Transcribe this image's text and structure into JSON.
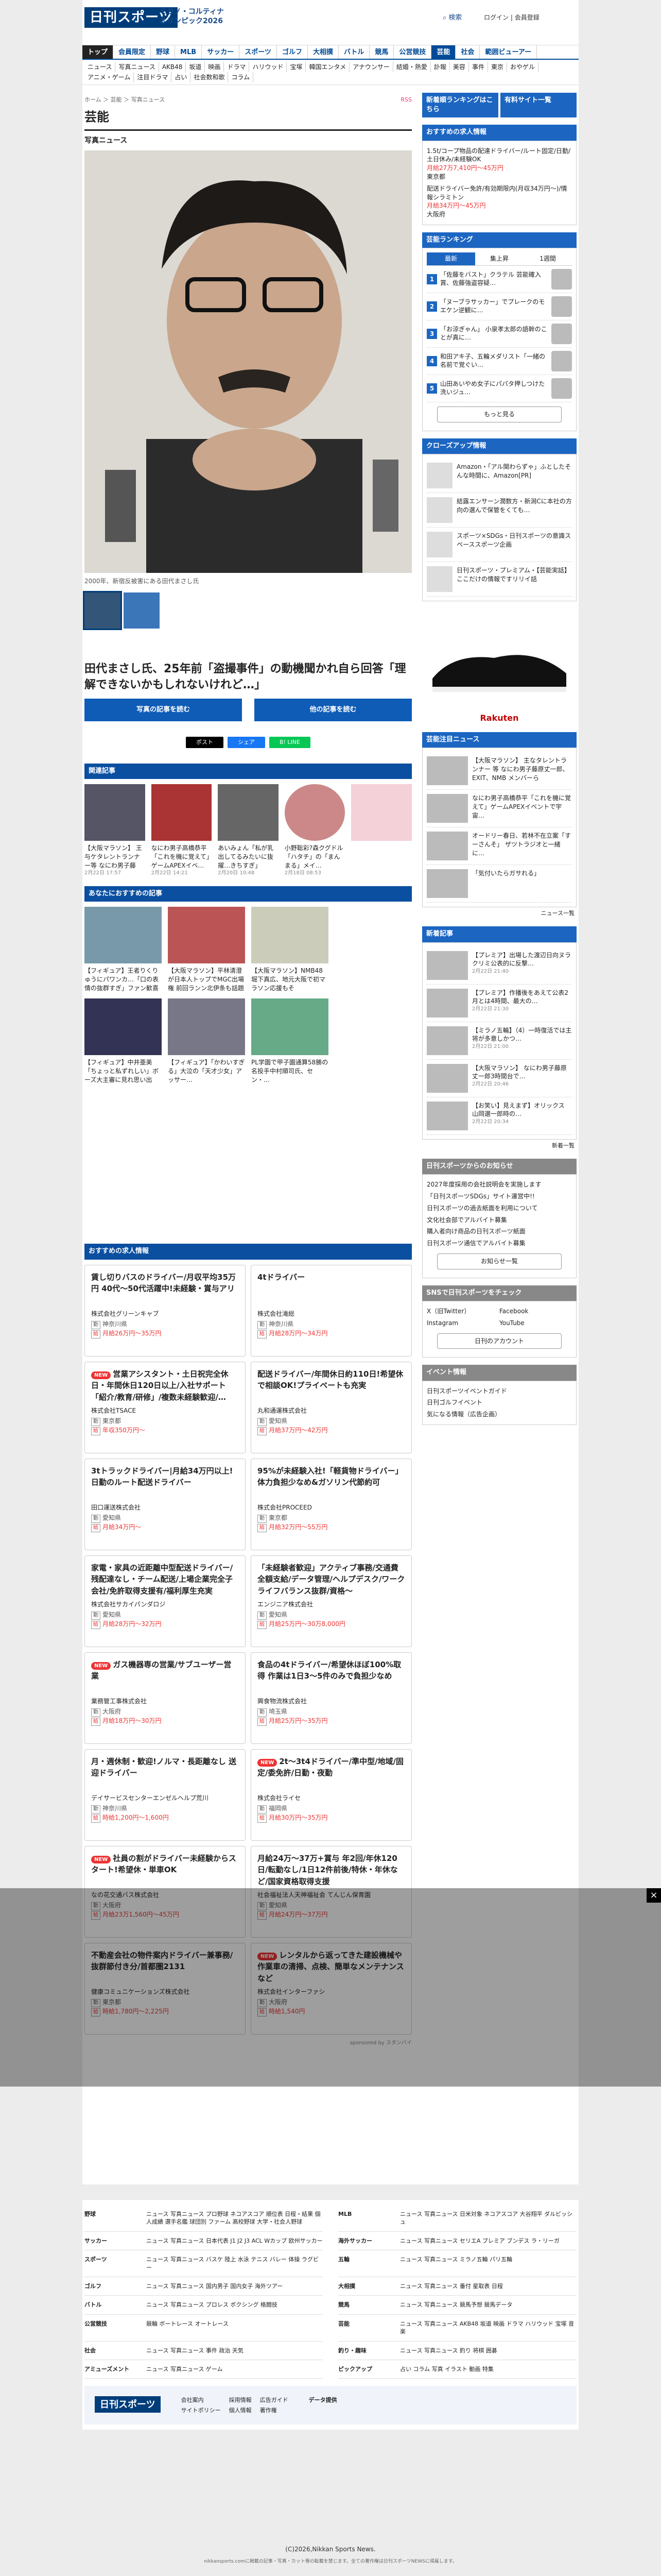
{
  "header": {
    "logo": "日刊スポーツ",
    "campaign": "ミラノ・コルティナ オリンピック2026",
    "search": "検索",
    "login": "ログイン",
    "register": "会員登録"
  },
  "nav": [
    "トップ",
    "会員限定",
    "野球",
    "MLB",
    "サッカー",
    "スポーツ",
    "ゴルフ",
    "大相撲",
    "バトル",
    "競馬",
    "公営競技",
    "芸能",
    "社会",
    "範囲ビューアー"
  ],
  "subnav": [
    "ニュース",
    "写真ニュース",
    "AKB48",
    "坂道",
    "映画",
    "ドラマ",
    "ハリウッド",
    "宝塚",
    "韓国エンタメ",
    "アナウンサー",
    "結婚・熱愛",
    "訃報",
    "美容",
    "事件",
    "東京",
    "おやゲル",
    "アニメ・ゲーム",
    "注目ドラマ",
    "占い",
    "社会数和歌",
    "コラム"
  ],
  "crumb": "ホーム ＞ 芸能 ＞ 写真ニュース",
  "rss": "RSS",
  "page_title": "芸能",
  "photo_heading": "写真ニュース",
  "caption": "2000年、新宿反被害にある田代まさし氏",
  "headline": "田代まさし氏、25年前「盗撮事件」の動機聞かれ自ら回答「理解できないかもしれないけれど…」",
  "prev_btn": "写真の記事を読む",
  "next_btn": "他の記事を読む",
  "share": [
    "ポスト",
    "シェア",
    "B! LINE",
    "はてな"
  ],
  "related_title": "関連記事",
  "related": [
    {
      "t": "【大阪マラソン】 王与ケタレントランナー等 なにわ男子藤原…",
      "d": "2月22日 17:57"
    },
    {
      "t": "なにわ男子高橋恭平「これを機に覚えて」ゲームAPEXイベ…",
      "d": "2月22日 14:21"
    },
    {
      "t": "あいみょん「私が乳出してるみたいに抜擢…きちすぎ」",
      "d": "2月20日 10:48"
    },
    {
      "t": "小野聡彩?森クグドル「ハタチ」の「まんまる」メイ…",
      "d": "2月18日 08:53"
    },
    {
      "t": "",
      "d": ""
    }
  ],
  "rec_title": "あなたにおすすめの記事",
  "rec": [
    {
      "t": "【フィギュア】王者りくりゅうにパワンカ…「口の表情の抜群すぎ」ファン歓喜"
    },
    {
      "t": "【大阪マラソン】平林清澄が日本人トップでMGC出場権 前回ランン北伊条も話題"
    },
    {
      "t": "【大阪マラソン】NMB48堀下真広、地元大阪で初マラソン応援もそ"
    },
    {
      "t": "",
      "d": ""
    },
    {
      "t": "【フィギュア】中井亜美「ちょっと私ずれしい」ボーズ大主審に見れ思い出"
    },
    {
      "t": "【フィギュア】「かわいすぎる」大泣の「天才少女」アッサー…"
    },
    {
      "t": "PL学園で甲子園通算58勝の名投手中村順司氏、セン・…"
    },
    {
      "t": "",
      "d": ""
    }
  ],
  "jobs_title": "おすすめの求人情報",
  "jobs": [
    {
      "new": false,
      "t": "賃し切りバスのドライバー/月収平均35万円 40代〜50代活躍中!未経験・賞与アリ",
      "co": "株式会社グリーンキャブ",
      "pref": "神奈川県",
      "pay": "月給26万円〜35万円"
    },
    {
      "new": false,
      "t": "4tドライバー",
      "co": "株式会社滝総",
      "pref": "神奈川県",
      "pay": "月給28万円〜34万円"
    },
    {
      "new": true,
      "t": "営業アシスタント・土日祝完全休日・年間休日120日以上/入社サポート「紹介/教育/研修」/複数未経験歓迎/…",
      "co": "株式会社TSACE",
      "pref": "東京都",
      "pay": "年収350万円〜"
    },
    {
      "new": false,
      "t": "配送ドライバー/年間休日約110日!希望休で相談OK!プライベートも充実",
      "co": "丸和通運株式会社",
      "pref": "愛知県",
      "pay": "月給37万円〜42万円"
    },
    {
      "new": false,
      "t": "3tトラックドライバー|月給34万円以上!日勤のルート配送ドライバー",
      "co": "田口運送株式会社",
      "pref": "愛知県",
      "pay": "月給34万円〜"
    },
    {
      "new": false,
      "t": "95%が未経験入社!「軽貨物ドライバー」体力負担少なめ&ガソリン代節約可",
      "co": "株式会社PROCEED",
      "pref": "東京都",
      "pay": "月給32万円〜55万円"
    },
    {
      "new": false,
      "t": "家電・家具の近距離中型配送ドライバー/残配達なし・チーム配送/上場企業完全子会社/免許取得支援有/福利厚生充実",
      "co": "株式会社サカイパンダロジ",
      "pref": "愛知県",
      "pay": "月給28万円〜32万円"
    },
    {
      "new": false,
      "t": "「未経験者歓迎」アクティブ事務/交通費全額支給/データ管理/ヘルプデスク/ワークライフバランス抜群/資格〜",
      "co": "エンジニア株式会社",
      "pref": "愛知県",
      "pay": "月給25万円〜30万8,000円"
    },
    {
      "new": true,
      "t": "ガス機器専の営業/サブユーザー営業",
      "co": "業務管工事株式会社",
      "pref": "大阪府",
      "pay": "月給18万円〜30万円"
    },
    {
      "new": false,
      "t": "食品の4tドライバー/希望休ほぼ100%取得 作業は1日3〜5件のみで負担少なめ",
      "co": "興食物流株式会社",
      "pref": "埼玉県",
      "pay": "月給25万円〜35万円"
    },
    {
      "new": false,
      "t": "月・週休制・歓迎!ノルマ・長距離なし 送迎ドライバー",
      "co": "デイサービスセンターエンゼルヘルプ荒川",
      "pref": "神奈川県",
      "pay": "時給1,200円〜1,600円"
    },
    {
      "new": true,
      "t": "2t〜3t4ドライバー/準中型/地域/固定/委免許/日勤・夜勤",
      "co": "株式会社ライセ",
      "pref": "福岡県",
      "pay": "月給30万円〜35万円"
    },
    {
      "new": true,
      "t": "社員の割がドライバー未経験からスタート!希望休・単車OK",
      "co": "なの花交通バス株式会社",
      "pref": "大阪府",
      "pay": "月給23万1,560円〜45万円"
    },
    {
      "new": false,
      "t": "月給24万〜37万+賞与 年2回/年休120日/転勤なし/1日12件前後/特休・年休など/国家資格取得支援",
      "co": "社会福祉法人天神福祉会 てんじん保育園",
      "pref": "愛知県",
      "pay": "月給24万円〜37万円"
    },
    {
      "new": false,
      "t": "不動産会社の物件案内ドライバー兼事務/抜群節付き分/首都圏2131",
      "co": "健康コミュニケーションズ株式会社",
      "pref": "東京都",
      "pay": "時給1,780円〜2,225円"
    },
    {
      "new": true,
      "t": "レンタルから返ってきた建設機械や作業車の清掃、点検、簡単なメンテナンスなど",
      "co": "株式会社インターファシ",
      "pref": "大阪府",
      "pay": "時給1,540円"
    }
  ],
  "sponsor": "sponsored by スタンバイ",
  "side": {
    "links": [
      "新着順ランキングはこちら",
      "有料サイト一覧"
    ],
    "jobs_title": "おすすめの求人情報",
    "jobs": [
      {
        "t": "1.5t/コープ物品の配達ドライバー/ルート固定/日勤/土日休み/未経験OK",
        "pay": "月給27万7,410円〜45万円",
        "pref": "東京都"
      },
      {
        "t": "配送ドライバー免許/有効期限内(月収34万円〜)/情報シラミトン",
        "pay": "月給34万円〜45万円",
        "pref": "大阪府"
      }
    ],
    "rank_title": "芸能ランキング",
    "rank_tabs": [
      "最新",
      "集上昇",
      "1週間"
    ],
    "ranks": [
      "「佐藤をバスト」クラテル 芸能確入賞、佐藤強盗容疑…",
      "「ヌーブラサッカー」でプレークのモエケン逆観に…",
      "「お涼ぎゃん」 小泉孝太郎の語幹のことが真に…",
      "和田アキ子、五輪メダリスト「一緒の名前で覚ぐい…",
      "山田あいやめ女子にパパタ押しつけた洗いジュ…"
    ],
    "rank_more": "もっと見る",
    "closeup_title": "クローズアップ情報",
    "closeup": [
      {
        "t": "Amazon・「アル関わらずゃ」ふとしたそんな時間に、Amazon[PR]"
      },
      {
        "t": "結露エンサーン潤数方・新潟Cに本社の方向の選んで保管をくても…"
      },
      {
        "t": "スポーツ×SDGs・日刊スポーツの意識スペーススポーツ企画"
      },
      {
        "t": "日刊スポーツ・プレミアム・【芸能実話】ここだけの情報ですリリイ話"
      }
    ],
    "shoe_brand": "Rakuten",
    "pick_title": "芸能注目ニュース",
    "picks": [
      "【大阪マラソン】 主なタレントランナー 等 なにわ男子藤原丈一郎、EXIT、NMB メンバーら",
      "なにわ男子高橋恭平「これを機に覚えて」ゲームAPEXイベントで宇宙…",
      "オードリー春日、若林不在立案「すーさんそ」 ザツトラジオと一緒に…",
      "「気付いたらガサれる」"
    ],
    "pick_more": "ニュース一覧",
    "new_title": "新着記事",
    "news": [
      {
        "t": "【プレミア】出場した渡辺日向ヌラクリミ公表的に反撃…",
        "d": "2月22日 21:40"
      },
      {
        "t": "【プレミア】作播後をあえて公表2月とは4時間、最大の…",
        "d": "2月22日 21:30"
      },
      {
        "t": "【ミラノ五輪】（4）一時復活では主将が多意しかつ…",
        "d": "2月22日 21:00"
      },
      {
        "t": "【大阪マラソン】 なにわ男子藤原丈一郎3時間台で…",
        "d": "2月22日 20:46"
      },
      {
        "t": "【お笑い】見えまず】オリックス 山岡選一郎時の…",
        "d": "2月22日 20:34"
      }
    ],
    "new_more": "新着一覧",
    "info_title": "日刊スポーツからのお知らせ",
    "info": [
      "2027年度採用の会社説明会を実施します",
      "「日刊スポーツSDGs」サイト運営中!!",
      "日刊スポーツの過去紙面を利用について",
      "文化社会部でアルバイト募集",
      "購入者向け商品の日刊スポーツ紙面",
      "日刊スポーツ通信でアルバイト募集"
    ],
    "info_more": "お知らせ一覧",
    "sns_title": "SNSで日刊スポーツをチェック",
    "sns": [
      "X（旧Twitter）",
      "Facebook",
      "Instagram",
      "YouTube"
    ],
    "sns_more": "日刊のアカウント",
    "event_title": "イベント情報",
    "events": [
      "日刊スポーツイベントガイド",
      "日刊ゴルフイベント",
      "気になる情報（広告企画）"
    ]
  },
  "footer": {
    "rows": [
      {
        "h": "野球",
        "v": "ニュース 写真ニュース プロ野球 ネコアスコア 順位表 日程・結果 個人成績 選手名鑑 球団別 ファーム 高校野球 大学・社会人野球"
      },
      {
        "h": "MLB",
        "v": "ニュース 写真ニュース 日米対象 ネコアスコア 大谷翔平 ダルビッシュ"
      },
      {
        "h": "サッカー",
        "v": "ニュース 写真ニュース 日本代表 J1 J2 J3 ACL Wカップ 欧州サッカー"
      },
      {
        "h": "海外サッカー",
        "v": "ニュース 写真ニュース セリエA プレミア ブンデス ラ・リーガ"
      },
      {
        "h": "スポーツ",
        "v": "ニュース 写真ニュース バスケ 陸上 水泳 テニス バレー 体操 ラグビー"
      },
      {
        "h": "五輪",
        "v": "ニュース 写真ニュース ミラノ五輪 パリ五輪"
      },
      {
        "h": "ゴルフ",
        "v": "ニュース 写真ニュース 国内男子 国内女子 海外ツアー"
      },
      {
        "h": "大相撲",
        "v": "ニュース 写真ニュース 番付 星取表 日程"
      },
      {
        "h": "バトル",
        "v": "ニュース 写真ニュース プロレス ボクシング 格闘技"
      },
      {
        "h": "競馬",
        "v": "ニュース 写真ニュース 競馬予想 競馬データ"
      },
      {
        "h": "公営競技",
        "v": "競輪 ボートレース オートレース"
      },
      {
        "h": "芸能",
        "v": "ニュース 写真ニュース AKB48 坂道 映画 ドラマ ハリウッド 宝塚 音楽"
      },
      {
        "h": "社会",
        "v": "ニュース 写真ニュース 事件 政治 天気"
      },
      {
        "h": "釣り・趣味",
        "v": "ニュース 写真ニュース 釣り 将棋 囲碁"
      },
      {
        "h": "アミューズメント",
        "v": "ニュース 写真ニュース ゲーム"
      },
      {
        "h": "ピックアップ",
        "v": "占い コラム 写真 イラスト 動画 特集"
      }
    ],
    "links": [
      "会社案内",
      "採用情報",
      "広告ガイド",
      "サイトポリシー",
      "個人情報",
      "著作権"
    ],
    "data": "データ提供"
  },
  "copy": "(C)2026,Nikkan Sports News.",
  "copy2": "nikkansports.comに掲載の記事・写真・カット等の転載を禁じます。全ての著作権は日刊スポーツNEWSに帰属します。",
  "overlay_close": "×"
}
